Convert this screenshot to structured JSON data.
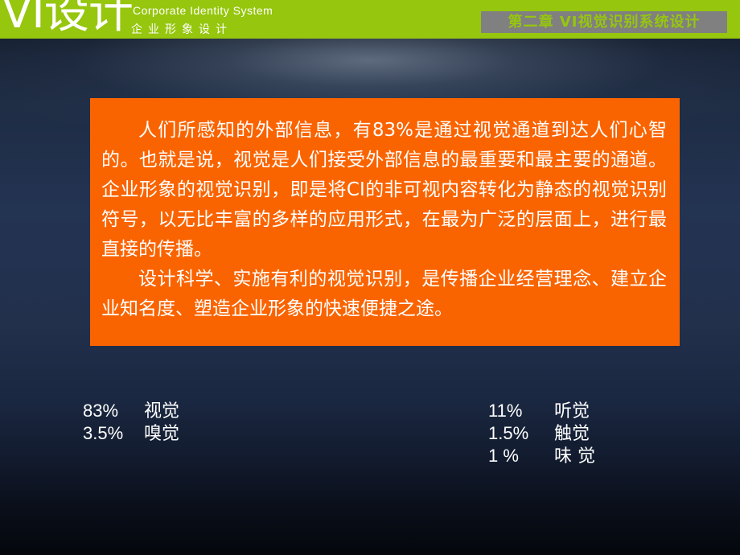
{
  "header": {
    "logo_mark": "VI设计",
    "logo_subtitle_en": "Corporate  Identity  System",
    "logo_subtitle_cn": "企业形象设计",
    "chapter_badge": "第二章 VI视觉识别系统设计",
    "bar_color": "#96c60d",
    "badge_bg_color": "#808080",
    "badge_text_color": "#96c60d"
  },
  "content_panel": {
    "bg_color": "#fa6400",
    "text_color": "#ffffff",
    "paragraphs": [
      "人们所感知的外部信息，有83%是通过视觉通道到达人们心智的。也就是说，视觉是人们接受外部信息的最重要和最主要的通道。企业形象的视觉识别，即是将CI的非可视内容转化为静态的视觉识别符号，以无比丰富的多样的应用形式，在最为广泛的层面上，进行最直接的传播。",
      "设计科学、实施有利的视觉识别，是传播企业经营理念、建立企业知名度、塑造企业形象的快速便捷之途。"
    ]
  },
  "statistics": {
    "left_column": [
      {
        "value": "83%",
        "label": "视觉"
      },
      {
        "value": "3.5%",
        "label": "嗅觉"
      }
    ],
    "right_column": [
      {
        "value": "11%",
        "label": "听觉"
      },
      {
        "value": "1.5%",
        "label": "触觉"
      },
      {
        "value": "1  %",
        "label": "味 觉"
      }
    ]
  },
  "background": {
    "top_color": "#0d1420",
    "mid_color": "#233352",
    "bottom_color": "#04070c"
  }
}
